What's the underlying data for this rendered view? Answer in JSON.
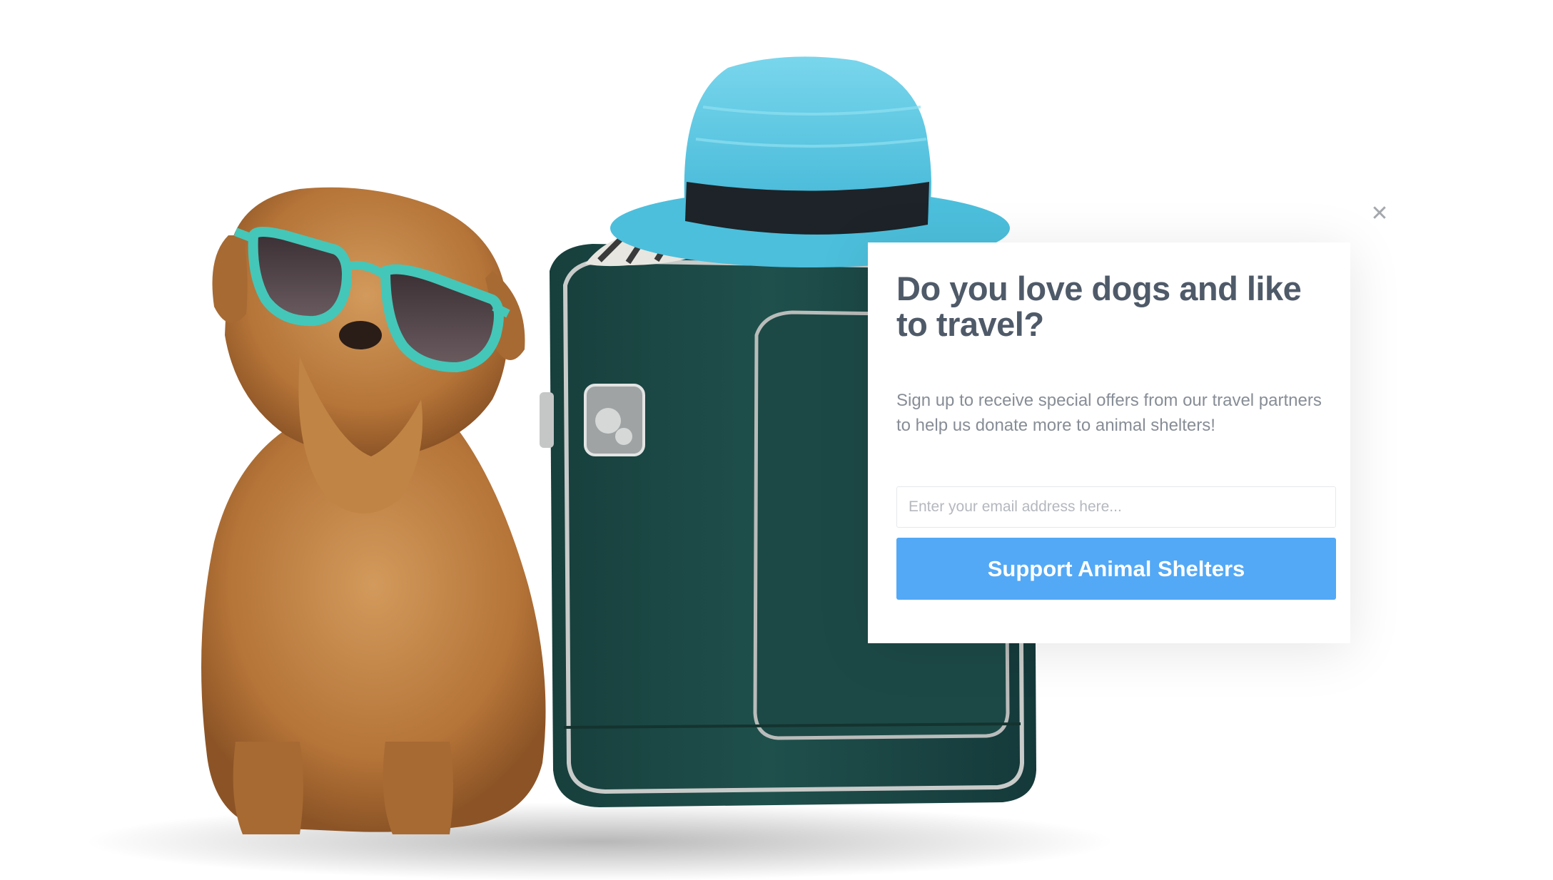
{
  "popup": {
    "title": "Do you love dogs and like to travel?",
    "body": "Sign up to receive special offers from our travel partners to help us donate more to animal shelters!",
    "email_placeholder": "Enter your email address here...",
    "email_value": "",
    "submit_label": "Support Animal Shelters",
    "close_icon": "close-icon"
  },
  "colors": {
    "title": "#4f5a69",
    "body_text": "#878d96",
    "button_bg": "#53a9f5",
    "button_text": "#ffffff",
    "close_icon": "#a4a8ad",
    "suitcase": "#1e4c48",
    "hat": "#5cc8e3",
    "dog_fur": "#b97a3e"
  },
  "background_image": {
    "subjects": [
      "dog-with-sunglasses",
      "green-suitcase",
      "blue-straw-hat"
    ]
  }
}
